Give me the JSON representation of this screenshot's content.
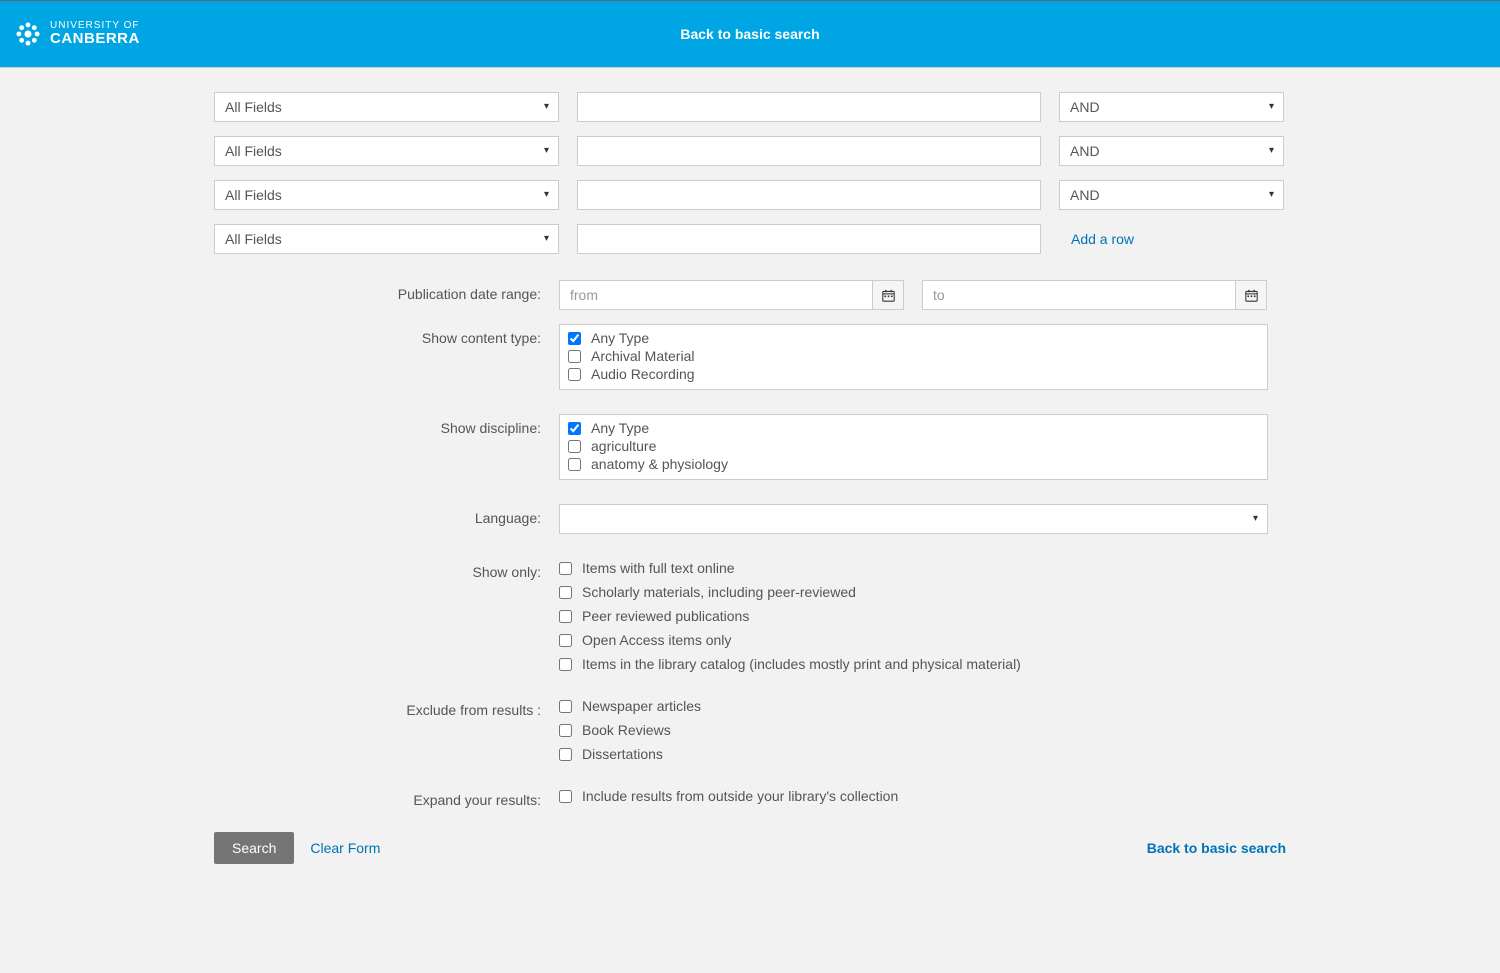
{
  "header": {
    "logo_top": "UNIVERSITY OF",
    "logo_bottom": "CANBERRA",
    "back_basic": "Back to basic search"
  },
  "search_rows": [
    {
      "field": "All Fields",
      "term": "",
      "operator": "AND"
    },
    {
      "field": "All Fields",
      "term": "",
      "operator": "AND"
    },
    {
      "field": "All Fields",
      "term": "",
      "operator": "AND"
    },
    {
      "field": "All Fields",
      "term": "",
      "operator": ""
    }
  ],
  "add_row_label": "Add a row",
  "labels": {
    "pub_date": "Publication date range:",
    "content_type": "Show content type:",
    "discipline": "Show discipline:",
    "language": "Language:",
    "show_only": "Show only:",
    "exclude": "Exclude from results :",
    "expand": "Expand your results:"
  },
  "date": {
    "from_placeholder": "from",
    "to_placeholder": "to"
  },
  "content_types": [
    {
      "label": "Any Type",
      "checked": true
    },
    {
      "label": "Archival Material",
      "checked": false
    },
    {
      "label": "Audio Recording",
      "checked": false
    }
  ],
  "disciplines": [
    {
      "label": "Any Type",
      "checked": true
    },
    {
      "label": "agriculture",
      "checked": false
    },
    {
      "label": "anatomy & physiology",
      "checked": false
    }
  ],
  "language_value": "",
  "show_only": [
    "Items with full text online",
    "Scholarly materials, including peer-reviewed",
    "Peer reviewed publications",
    "Open Access items only",
    "Items in the library catalog (includes mostly print and physical material)"
  ],
  "exclude": [
    "Newspaper articles",
    "Book Reviews",
    "Dissertations"
  ],
  "expand": [
    "Include results from outside your library's collection"
  ],
  "buttons": {
    "search": "Search",
    "clear": "Clear Form",
    "back": "Back to basic search"
  }
}
